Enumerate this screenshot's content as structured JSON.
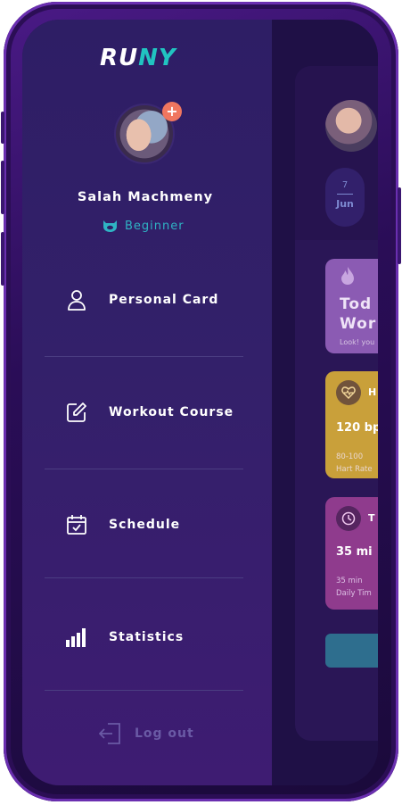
{
  "app": {
    "logo_part1": "RU",
    "logo_part2": "NY",
    "accent": "#21c4c1"
  },
  "profile": {
    "name": "Salah Machmeny",
    "level": "Beginner",
    "add_badge": "+"
  },
  "menu": [
    {
      "label": "Personal Card",
      "icon": "user-icon"
    },
    {
      "label": "Workout Course",
      "icon": "edit-icon"
    },
    {
      "label": "Schedule",
      "icon": "calendar-check-icon"
    },
    {
      "label": "Statistics",
      "icon": "bar-chart-icon"
    }
  ],
  "logout": {
    "label": "Log out",
    "icon": "logout-icon"
  },
  "background": {
    "date_day": "7",
    "date_month": "Jun",
    "tile_workout_title_1": "Tod",
    "tile_workout_title_2": "Wor",
    "tile_workout_sub": "Look! you",
    "tile_heart_head": "H",
    "tile_heart_value": "120 bp",
    "tile_heart_range": "80-100",
    "tile_heart_caption": "Hart Rate",
    "tile_time_head": "T",
    "tile_time_value": "35 mi",
    "tile_time_sub1": "35 min",
    "tile_time_sub2": "Daily Tim"
  }
}
